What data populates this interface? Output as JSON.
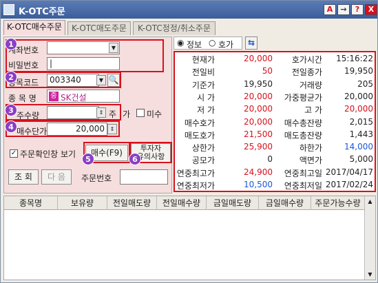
{
  "window": {
    "title": "K-OTC주문"
  },
  "titlebar_buttons": [
    "A",
    "→",
    "?",
    "X"
  ],
  "tabs": [
    {
      "label": "K-OTC매수주문",
      "active": true
    },
    {
      "label": "K-OTC매도주문",
      "active": false
    },
    {
      "label": "K-OTC정정/취소주문",
      "active": false
    }
  ],
  "form": {
    "account_label": "계좌번호",
    "account_value": "",
    "password_label": "비밀번호",
    "password_value": "|",
    "code_label": "종목코드",
    "code_value": "003340",
    "name_label": "종 목 명",
    "name_badge": "중",
    "name_value": "SK건설",
    "qty_label": "주수량",
    "qty_value": "",
    "qty_unit": "주",
    "qty_btn": "가",
    "unfilled_label": "미수",
    "price_label": "매수단가",
    "price_value": "20,000",
    "confirm_label": "주문확인창 보기",
    "buy_btn": "매수(F9)",
    "notice_btn": "투자자\n유의사항",
    "query_btn": "조 회",
    "next_btn": "다 음",
    "order_no_label": "주문번호",
    "order_no_value": ""
  },
  "markers": [
    "1",
    "2",
    "3",
    "4",
    "5",
    "6"
  ],
  "info_toggle": {
    "opt1": "정보",
    "opt2": "호가"
  },
  "info": [
    {
      "k1": "현재가",
      "v1": "20,000",
      "c1": "red",
      "k2": "호가시간",
      "v2": "15:16:22",
      "c2": ""
    },
    {
      "k1": "전일비",
      "v1": "50",
      "c1": "red",
      "k2": "전일종가",
      "v2": "19,950",
      "c2": ""
    },
    {
      "k1": "기준가",
      "v1": "19,950",
      "c1": "",
      "k2": "거래량",
      "v2": "205",
      "c2": ""
    },
    {
      "k1": "시  가",
      "v1": "20,000",
      "c1": "red",
      "k2": "가중평균가",
      "v2": "20,000",
      "c2": ""
    },
    {
      "k1": "저  가",
      "v1": "20,000",
      "c1": "red",
      "k2": "고  가",
      "v2": "20,000",
      "c2": "red"
    },
    {
      "k1": "매수호가",
      "v1": "20,000",
      "c1": "red",
      "k2": "매수총잔량",
      "v2": "2,015",
      "c2": ""
    },
    {
      "k1": "매도호가",
      "v1": "21,500",
      "c1": "red",
      "k2": "매도총잔량",
      "v2": "1,443",
      "c2": ""
    },
    {
      "k1": "상한가",
      "v1": "25,900",
      "c1": "red",
      "k2": "하한가",
      "v2": "14,000",
      "c2": "blue"
    },
    {
      "k1": "공모가",
      "v1": "0",
      "c1": "",
      "k2": "액면가",
      "v2": "5,000",
      "c2": ""
    },
    {
      "k1": "연중최고가",
      "v1": "24,900",
      "c1": "red",
      "k2": "연중최고일",
      "v2": "2017/04/17",
      "c2": ""
    },
    {
      "k1": "연중최저가",
      "v1": "10,500",
      "c1": "blue",
      "k2": "연중최저일",
      "v2": "2017/02/24",
      "c2": ""
    }
  ],
  "grid_headers": [
    "종목명",
    "보유량",
    "전일매도량",
    "전일매수량",
    "금일매도량",
    "금일매수량",
    "주문가능수량"
  ],
  "colors": {
    "red": "#d8101c",
    "blue": "#1a56d6",
    "panel": "#f6dede",
    "marker": "#8a3fc4"
  }
}
